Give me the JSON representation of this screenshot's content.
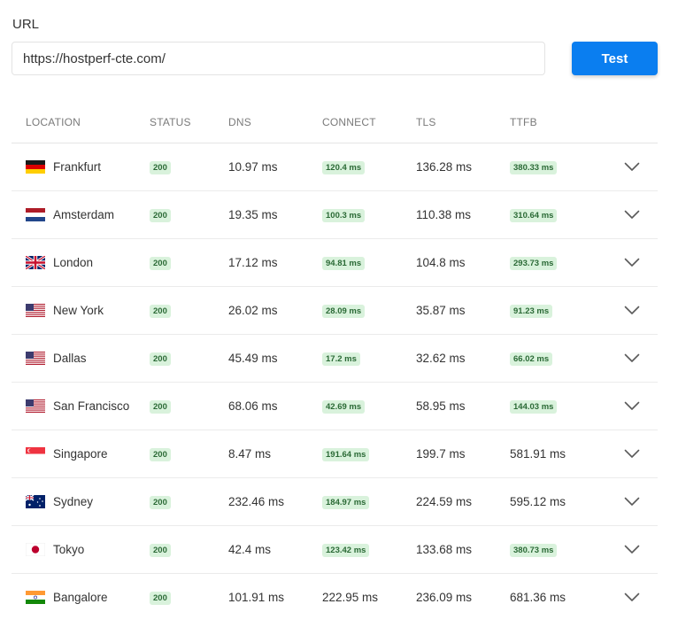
{
  "form": {
    "url_label": "URL",
    "url_value": "https://hostperf-cte.com/",
    "test_label": "Test"
  },
  "table": {
    "headers": {
      "location": "LOCATION",
      "status": "STATUS",
      "dns": "DNS",
      "connect": "CONNECT",
      "tls": "TLS",
      "ttfb": "TTFB"
    },
    "rows": [
      {
        "location": "Frankfurt",
        "flag": "germany-flag-icon",
        "status": "200",
        "dns": "10.97 ms",
        "connect": "120.4 ms",
        "connect_badge": true,
        "tls": "136.28 ms",
        "ttfb": "380.33 ms",
        "ttfb_badge": true
      },
      {
        "location": "Amsterdam",
        "flag": "netherlands-flag-icon",
        "status": "200",
        "dns": "19.35 ms",
        "connect": "100.3 ms",
        "connect_badge": true,
        "tls": "110.38 ms",
        "ttfb": "310.64 ms",
        "ttfb_badge": true
      },
      {
        "location": "London",
        "flag": "uk-flag-icon",
        "status": "200",
        "dns": "17.12 ms",
        "connect": "94.81 ms",
        "connect_badge": true,
        "tls": "104.8 ms",
        "ttfb": "293.73 ms",
        "ttfb_badge": true
      },
      {
        "location": "New York",
        "flag": "us-flag-icon",
        "status": "200",
        "dns": "26.02 ms",
        "connect": "28.09 ms",
        "connect_badge": true,
        "tls": "35.87 ms",
        "ttfb": "91.23 ms",
        "ttfb_badge": true
      },
      {
        "location": "Dallas",
        "flag": "us-flag-icon",
        "status": "200",
        "dns": "45.49 ms",
        "connect": "17.2 ms",
        "connect_badge": true,
        "tls": "32.62 ms",
        "ttfb": "66.02 ms",
        "ttfb_badge": true
      },
      {
        "location": "San Francisco",
        "flag": "us-flag-icon",
        "status": "200",
        "dns": "68.06 ms",
        "connect": "42.69 ms",
        "connect_badge": true,
        "tls": "58.95 ms",
        "ttfb": "144.03 ms",
        "ttfb_badge": true
      },
      {
        "location": "Singapore",
        "flag": "singapore-flag-icon",
        "status": "200",
        "dns": "8.47 ms",
        "connect": "191.64 ms",
        "connect_badge": true,
        "tls": "199.7 ms",
        "ttfb": "581.91 ms",
        "ttfb_badge": false
      },
      {
        "location": "Sydney",
        "flag": "australia-flag-icon",
        "status": "200",
        "dns": "232.46 ms",
        "connect": "184.97 ms",
        "connect_badge": true,
        "tls": "224.59 ms",
        "ttfb": "595.12 ms",
        "ttfb_badge": false
      },
      {
        "location": "Tokyo",
        "flag": "japan-flag-icon",
        "status": "200",
        "dns": "42.4 ms",
        "connect": "123.42 ms",
        "connect_badge": true,
        "tls": "133.68 ms",
        "ttfb": "380.73 ms",
        "ttfb_badge": true
      },
      {
        "location": "Bangalore",
        "flag": "india-flag-icon",
        "status": "200",
        "dns": "101.91 ms",
        "connect": "222.95 ms",
        "connect_badge": false,
        "tls": "236.09 ms",
        "ttfb": "681.36 ms",
        "ttfb_badge": false
      }
    ]
  },
  "colors": {
    "accent": "#0a7ef0",
    "badge_bg": "#d9f2dc",
    "badge_text": "#2b6a36"
  }
}
